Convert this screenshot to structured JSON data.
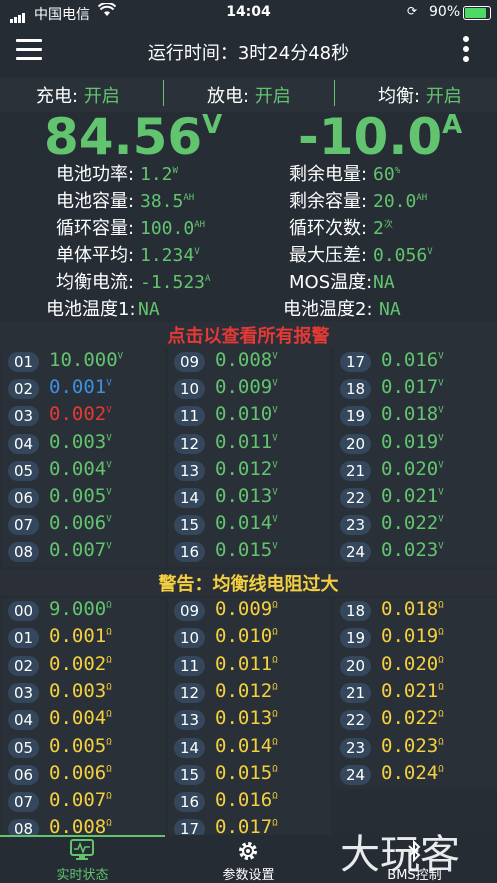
{
  "status_bar": {
    "carrier": "中国电信",
    "time": "14:04",
    "battery": "90%"
  },
  "header": {
    "title": "运行时间：3时24分48秒"
  },
  "toggles": [
    {
      "label": "充电:",
      "value": "开启"
    },
    {
      "label": "放电:",
      "value": "开启"
    },
    {
      "label": "均衡:",
      "value": "开启"
    }
  ],
  "voltage": {
    "value": "84.56",
    "unit": "V"
  },
  "current": {
    "value": "-10.0",
    "unit": "A"
  },
  "stats": [
    {
      "label": "电池功率:",
      "value": "1.2",
      "unit": "W"
    },
    {
      "label": "剩余电量:",
      "value": "60",
      "unit": "%"
    },
    {
      "label": "电池容量:",
      "value": "38.5",
      "unit": "AH"
    },
    {
      "label": "剩余容量:",
      "value": "20.0",
      "unit": "AH"
    },
    {
      "label": "循环容量:",
      "value": "100.0",
      "unit": "AH"
    },
    {
      "label": "循环次数:",
      "value": "2",
      "unit": "次"
    },
    {
      "label": "单体平均:",
      "value": "1.234",
      "unit": "V"
    },
    {
      "label": "最大压差:",
      "value": "0.056",
      "unit": "V"
    },
    {
      "label": "均衡电流:",
      "value": "-1.523",
      "unit": "A"
    },
    {
      "label": "MOS温度:",
      "value": "NA",
      "unit": ""
    },
    {
      "label": "电池温度1:",
      "value": "NA",
      "unit": ""
    },
    {
      "label": "电池温度2:",
      "value": "NA",
      "unit": ""
    }
  ],
  "alarm_text": "点击以查看所有报警",
  "warning_text": "警告：均衡线电阻过大",
  "colors": {
    "green": "#62c46f",
    "blue": "#3d8fe0",
    "red": "#e53935",
    "yellow": "#f4d03f"
  },
  "cells": [
    {
      "idx": "01",
      "val": "10.000",
      "unit": "V",
      "color": "green"
    },
    {
      "idx": "02",
      "val": "0.001",
      "unit": "V",
      "color": "blue"
    },
    {
      "idx": "03",
      "val": "0.002",
      "unit": "V",
      "color": "red"
    },
    {
      "idx": "04",
      "val": "0.003",
      "unit": "V",
      "color": "green"
    },
    {
      "idx": "05",
      "val": "0.004",
      "unit": "V",
      "color": "green"
    },
    {
      "idx": "06",
      "val": "0.005",
      "unit": "V",
      "color": "green"
    },
    {
      "idx": "07",
      "val": "0.006",
      "unit": "V",
      "color": "green"
    },
    {
      "idx": "08",
      "val": "0.007",
      "unit": "V",
      "color": "green"
    },
    {
      "idx": "09",
      "val": "0.008",
      "unit": "V",
      "color": "green"
    },
    {
      "idx": "10",
      "val": "0.009",
      "unit": "V",
      "color": "green"
    },
    {
      "idx": "11",
      "val": "0.010",
      "unit": "V",
      "color": "green"
    },
    {
      "idx": "12",
      "val": "0.011",
      "unit": "V",
      "color": "green"
    },
    {
      "idx": "13",
      "val": "0.012",
      "unit": "V",
      "color": "green"
    },
    {
      "idx": "14",
      "val": "0.013",
      "unit": "V",
      "color": "green"
    },
    {
      "idx": "15",
      "val": "0.014",
      "unit": "V",
      "color": "green"
    },
    {
      "idx": "16",
      "val": "0.015",
      "unit": "V",
      "color": "green"
    },
    {
      "idx": "17",
      "val": "0.016",
      "unit": "V",
      "color": "green"
    },
    {
      "idx": "18",
      "val": "0.017",
      "unit": "V",
      "color": "green"
    },
    {
      "idx": "19",
      "val": "0.018",
      "unit": "V",
      "color": "green"
    },
    {
      "idx": "20",
      "val": "0.019",
      "unit": "V",
      "color": "green"
    },
    {
      "idx": "21",
      "val": "0.020",
      "unit": "V",
      "color": "green"
    },
    {
      "idx": "22",
      "val": "0.021",
      "unit": "V",
      "color": "green"
    },
    {
      "idx": "23",
      "val": "0.022",
      "unit": "V",
      "color": "green"
    },
    {
      "idx": "24",
      "val": "0.023",
      "unit": "V",
      "color": "green"
    }
  ],
  "resistances": {
    "col1": [
      {
        "idx": "00",
        "val": "9.000",
        "unit": "Ω"
      },
      {
        "idx": "01",
        "val": "0.001",
        "unit": "Ω"
      },
      {
        "idx": "02",
        "val": "0.002",
        "unit": "Ω"
      },
      {
        "idx": "03",
        "val": "0.003",
        "unit": "Ω"
      },
      {
        "idx": "04",
        "val": "0.004",
        "unit": "Ω"
      },
      {
        "idx": "05",
        "val": "0.005",
        "unit": "Ω"
      },
      {
        "idx": "06",
        "val": "0.006",
        "unit": "Ω"
      },
      {
        "idx": "07",
        "val": "0.007",
        "unit": "Ω"
      },
      {
        "idx": "08",
        "val": "0.008",
        "unit": "Ω"
      }
    ],
    "col2": [
      {
        "idx": "09",
        "val": "0.009",
        "unit": "Ω"
      },
      {
        "idx": "10",
        "val": "0.010",
        "unit": "Ω"
      },
      {
        "idx": "11",
        "val": "0.011",
        "unit": "Ω"
      },
      {
        "idx": "12",
        "val": "0.012",
        "unit": "Ω"
      },
      {
        "idx": "13",
        "val": "0.013",
        "unit": "Ω"
      },
      {
        "idx": "14",
        "val": "0.014",
        "unit": "Ω"
      },
      {
        "idx": "15",
        "val": "0.015",
        "unit": "Ω"
      },
      {
        "idx": "16",
        "val": "0.016",
        "unit": "Ω"
      },
      {
        "idx": "17",
        "val": "0.017",
        "unit": "Ω"
      }
    ],
    "col3": [
      {
        "idx": "18",
        "val": "0.018",
        "unit": "Ω"
      },
      {
        "idx": "19",
        "val": "0.019",
        "unit": "Ω"
      },
      {
        "idx": "20",
        "val": "0.020",
        "unit": "Ω"
      },
      {
        "idx": "21",
        "val": "0.021",
        "unit": "Ω"
      },
      {
        "idx": "22",
        "val": "0.022",
        "unit": "Ω"
      },
      {
        "idx": "23",
        "val": "0.023",
        "unit": "Ω"
      },
      {
        "idx": "24",
        "val": "0.024",
        "unit": "Ω"
      }
    ]
  },
  "tabs": [
    {
      "label": "实时状态",
      "icon": "monitor-icon",
      "active": true
    },
    {
      "label": "参数设置",
      "icon": "gear-icon",
      "active": false
    },
    {
      "label": "BMS控制",
      "icon": "bluetooth-icon",
      "active": false
    }
  ],
  "watermark": "大玩客"
}
